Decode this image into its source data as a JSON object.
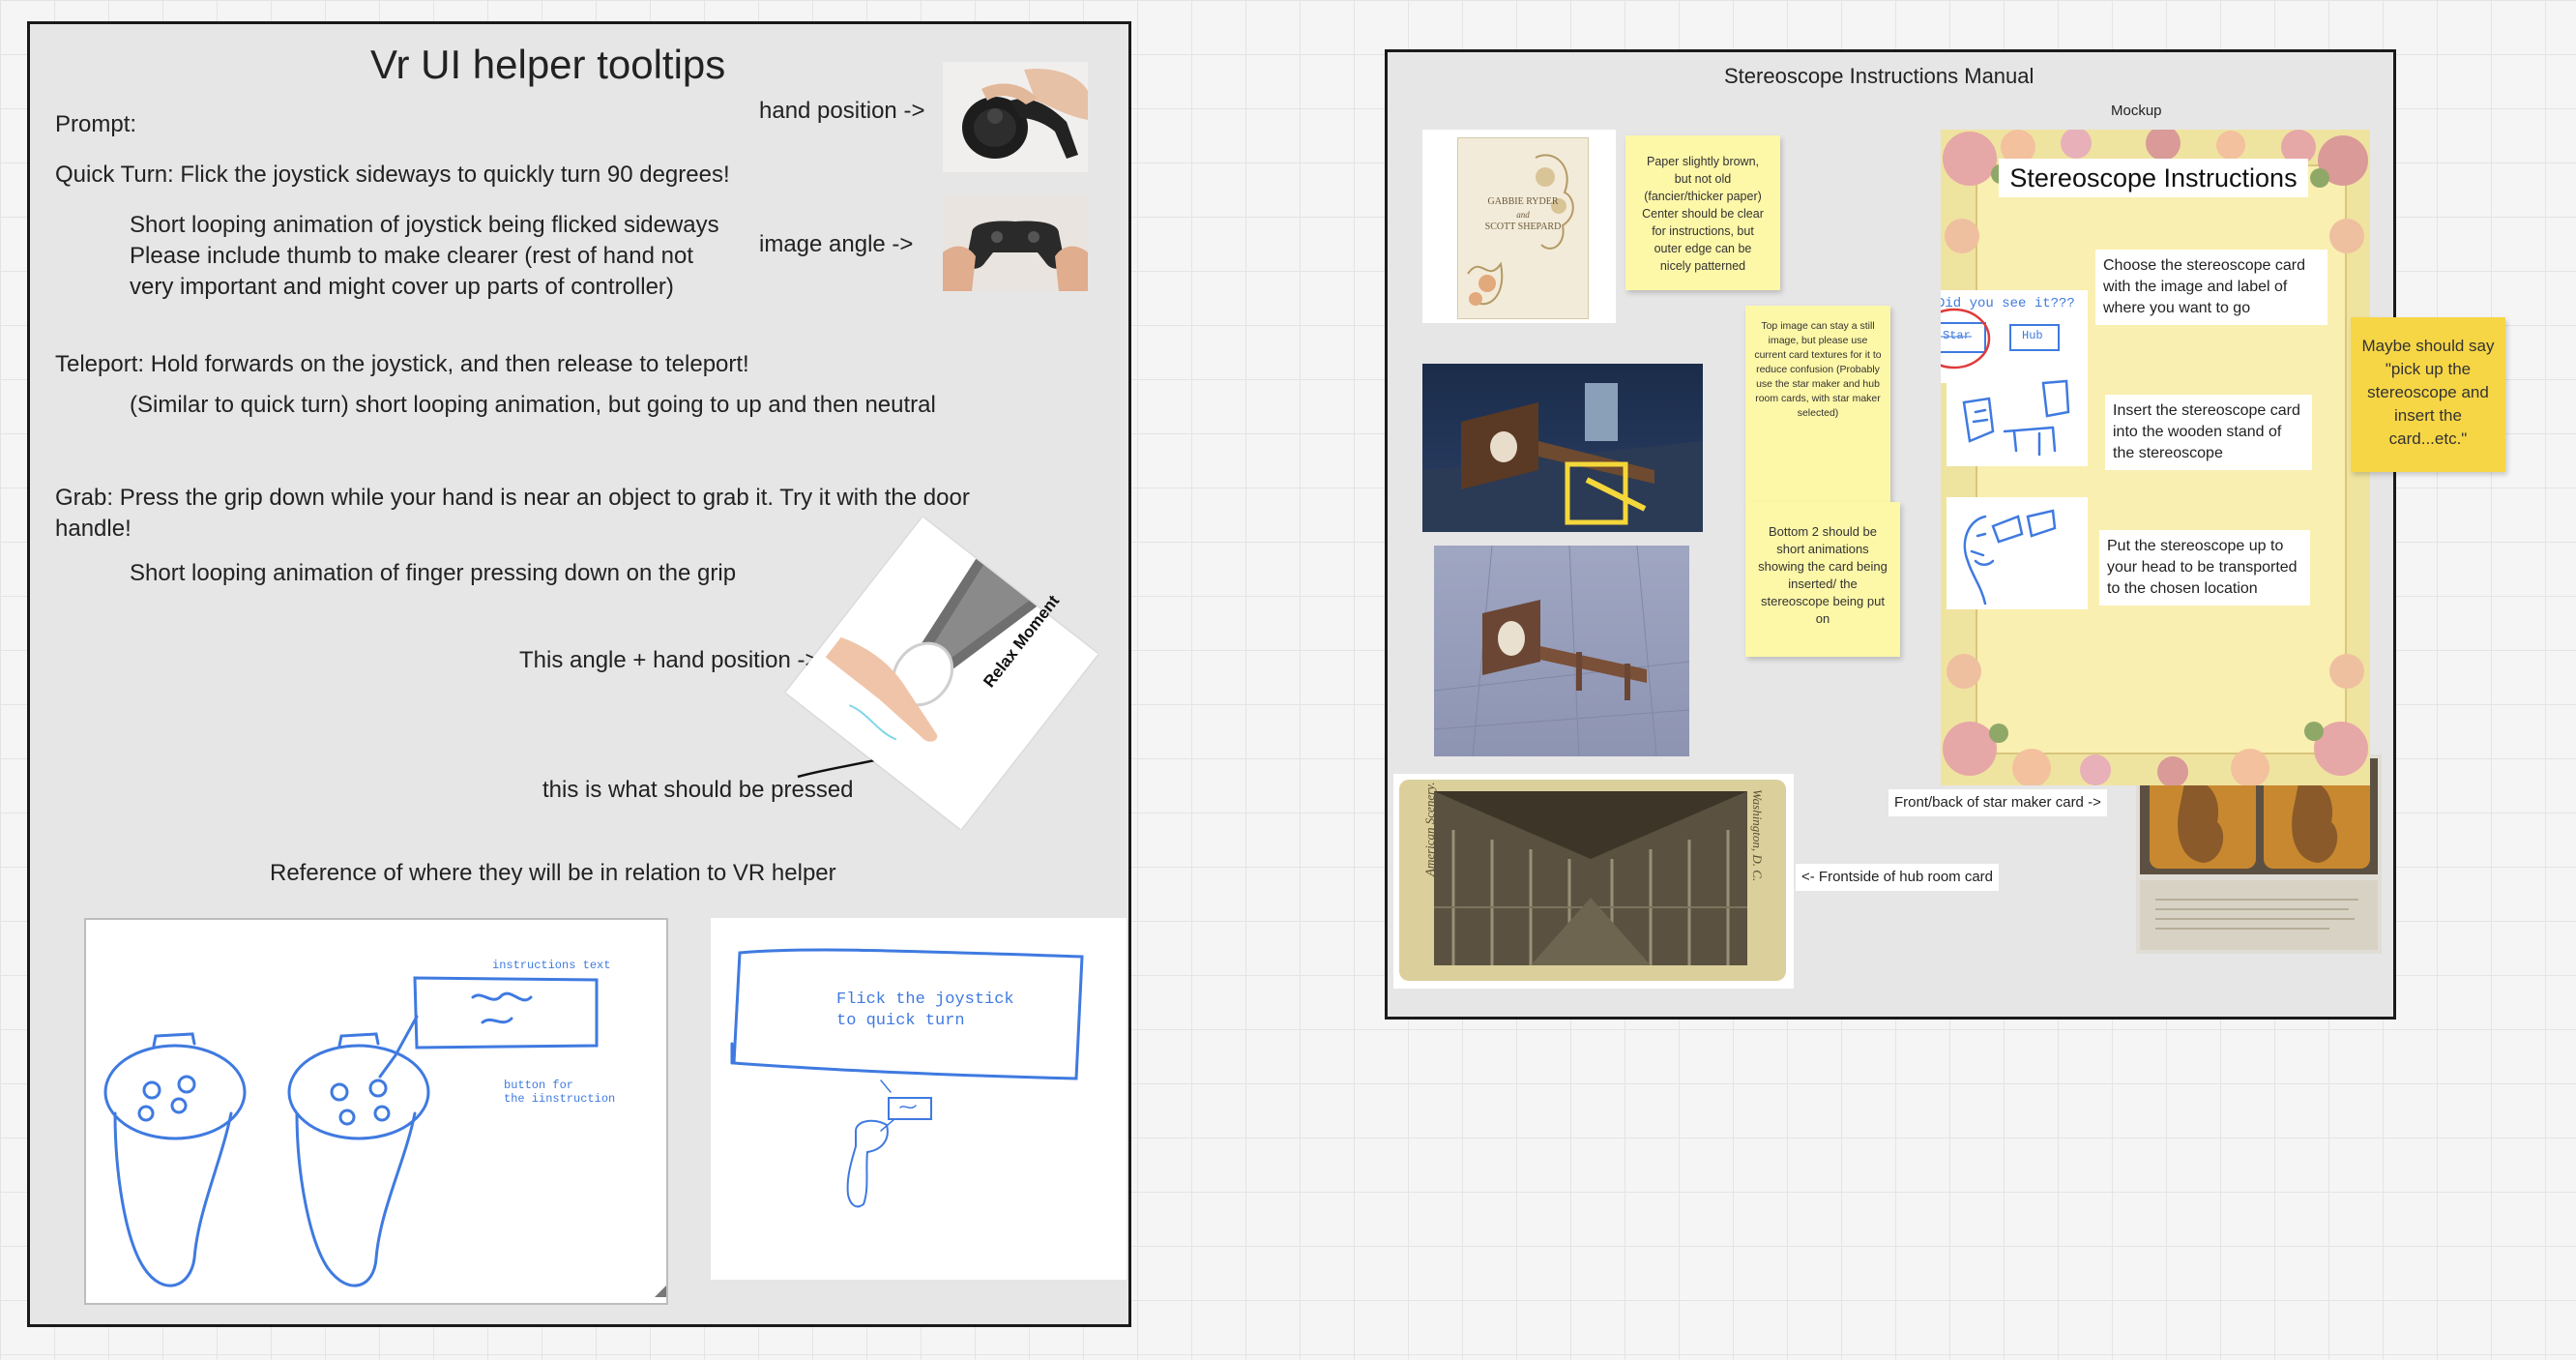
{
  "left_frame": {
    "title": "Vr UI helper tooltips",
    "prompt": "Prompt:",
    "quick_turn": "Quick Turn: Flick the joystick sideways to quickly turn 90 degrees!",
    "quick_turn_detail_1": "Short looping animation of joystick being flicked sideways",
    "quick_turn_detail_2": "Please include thumb to make clearer (rest of hand not",
    "quick_turn_detail_3": "very important and might cover up parts of controller)",
    "hand_position": "hand position ->",
    "image_angle": "image angle ->",
    "teleport": "Teleport: Hold forwards on the joystick, and then release to teleport!",
    "teleport_detail": "(Similar to quick turn) short looping animation, but going to up and then neutral",
    "grab_1": "Grab: Press the grip down while your hand is near an object to grab it. Try it with the door",
    "grab_2": "handle!",
    "grab_detail": "Short looping animation of finger pressing down on the grip",
    "angle_hand": "This angle + hand position ->",
    "pressed": "this is what should be pressed",
    "relax_title": "Relax Moment",
    "reference": "Reference of where they will be in relation to VR helper",
    "sketch1_instructions": "instructions text",
    "sketch1_button_1": "button for",
    "sketch1_button_2": "the iinstruction",
    "sketch2_text_1": "Flick the joystick",
    "sketch2_text_2": "to quick turn"
  },
  "right_frame": {
    "title": "Stereoscope Instructions Manual",
    "mockup_label": "Mockup",
    "mockup_title": "Stereoscope Instructions",
    "did_you_see": "Did you see it???",
    "star_label": "Star",
    "hub_label": "Hub",
    "step1": "Choose the  stereoscope card with the image and label of where you want to go",
    "step2": "Insert the stereoscope card into the wooden stand of the stereoscope",
    "step3": "Put the stereoscope up to your head to be transported to the chosen location",
    "sticky_paper": "Paper slightly brown, but not old (fancier/thicker paper) Center should be clear for instructions, but outer edge can be nicely patterned",
    "sticky_top_image": "Top image can stay a still image, but please use current card textures for it to reduce confusion (Probably use the star maker and hub room cards, with star maker selected)",
    "sticky_bottom": "Bottom 2 should be short animations showing the card being inserted/ the stereoscope being put on",
    "sticky_maybe": "Maybe should say \"pick up the stereoscope and insert the card...etc.\"",
    "front_back": "Front/back of star maker card ->",
    "frontside": "<- Frontside of hub room card",
    "invite_1": "GABBIE RYDER",
    "invite_2": "and",
    "invite_3": "SCOTT SHEPARD",
    "card_side_left": "American Scenery.",
    "card_side_right": "Washington, D. C."
  }
}
